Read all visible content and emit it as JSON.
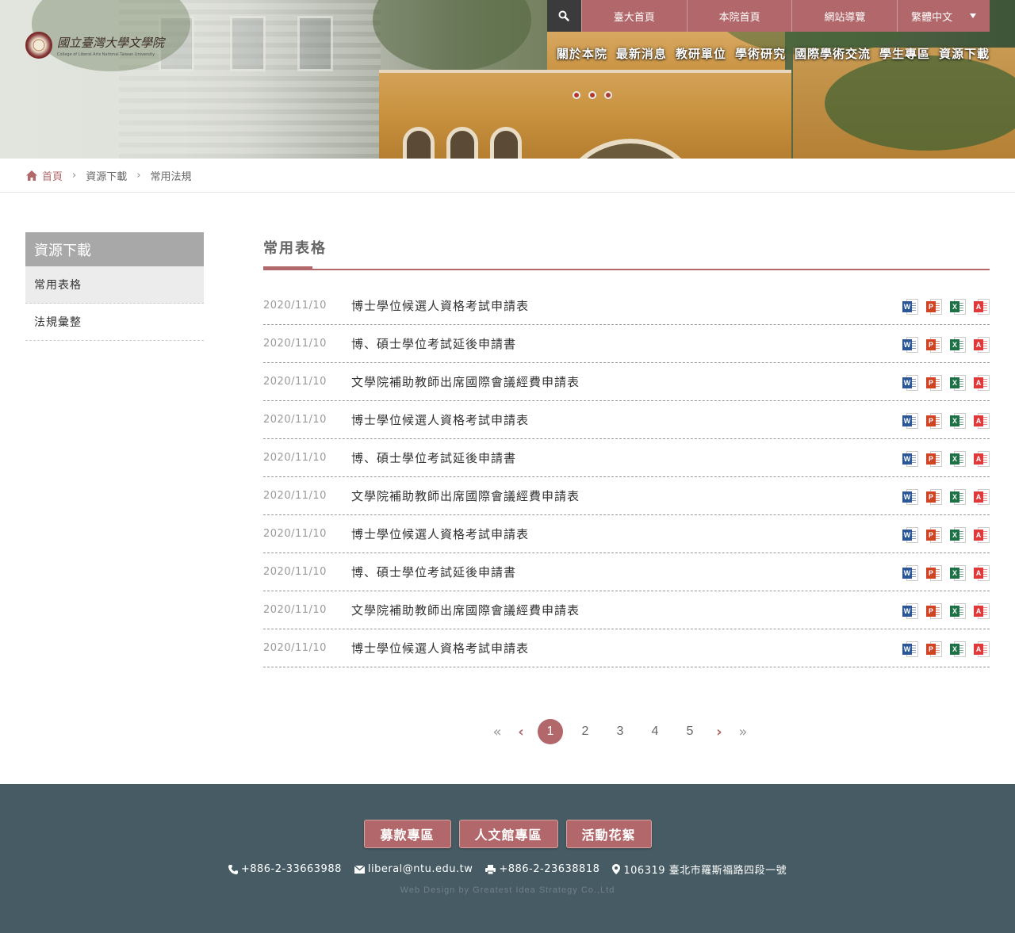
{
  "site": {
    "logo_name": "國立臺灣大學文學院",
    "logo_sub": "College of Liberal Arts  National Taiwan University"
  },
  "topnav": {
    "search_icon": "search-icon",
    "items": [
      "臺大首頁",
      "本院首頁",
      "網站導覽"
    ],
    "language": "繁體中文"
  },
  "mainnav": [
    "關於本院",
    "最新消息",
    "教研單位",
    "學術研究",
    "國際學術交流",
    "學生專區",
    "資源下載"
  ],
  "breadcrumb": {
    "home": "首頁",
    "level1": "資源下載",
    "level2": "常用法規"
  },
  "sidebar": {
    "title": "資源下載",
    "items": [
      "常用表格",
      "法規彙整"
    ]
  },
  "main": {
    "heading": "常用表格",
    "rows": [
      {
        "date": "2020/11/10",
        "title": "博士學位候選人資格考試申請表"
      },
      {
        "date": "2020/11/10",
        "title": "博、碩士學位考試延後申請書"
      },
      {
        "date": "2020/11/10",
        "title": "文學院補助教師出席國際會議經費申請表"
      },
      {
        "date": "2020/11/10",
        "title": "博士學位候選人資格考試申請表"
      },
      {
        "date": "2020/11/10",
        "title": "博、碩士學位考試延後申請書"
      },
      {
        "date": "2020/11/10",
        "title": "文學院補助教師出席國際會議經費申請表"
      },
      {
        "date": "2020/11/10",
        "title": "博士學位候選人資格考試申請表"
      },
      {
        "date": "2020/11/10",
        "title": "博、碩士學位考試延後申請書"
      },
      {
        "date": "2020/11/10",
        "title": "文學院補助教師出席國際會議經費申請表"
      },
      {
        "date": "2020/11/10",
        "title": "博士學位候選人資格考試申請表"
      }
    ],
    "file_icons": [
      {
        "name": "word-icon",
        "letter": "W"
      },
      {
        "name": "powerpoint-icon",
        "letter": "P"
      },
      {
        "name": "excel-icon",
        "letter": "X"
      },
      {
        "name": "pdf-icon",
        "letter": "A"
      }
    ]
  },
  "pagination": {
    "first": "«",
    "prev": "‹",
    "pages": [
      "1",
      "2",
      "3",
      "4",
      "5"
    ],
    "current": "1",
    "next": "›",
    "last": "»"
  },
  "footer": {
    "buttons": [
      "募款專區",
      "人文館專區",
      "活動花絮"
    ],
    "phone": "+886-2-33663988",
    "email": "liberal@ntu.edu.tw",
    "fax": "+886-2-23638818",
    "address": "106319 臺北市羅斯福路四段一號",
    "credit": "Web Design by Greatest Idea Strategy Co.,Ltd"
  },
  "colors": {
    "accent": "#b2676a",
    "footer_bg": "#465b63",
    "sidebar_title_bg": "#a8a8a8"
  }
}
